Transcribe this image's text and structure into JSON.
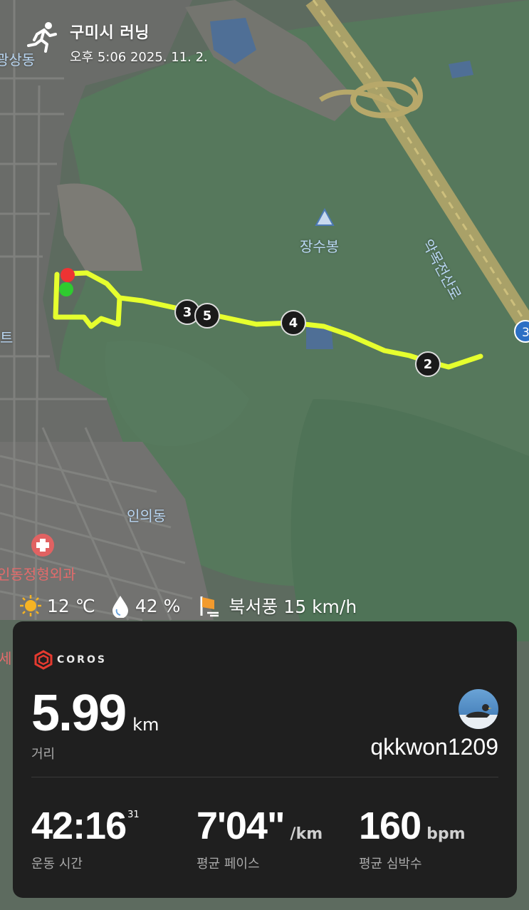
{
  "header": {
    "title": "구미시 러닝",
    "datetime": "오후 5:06 2025. 11. 2."
  },
  "map": {
    "labels": {
      "peak": "장수봉",
      "dong": "인의동",
      "road": "악목전산로",
      "top_left": "광상동",
      "left_edge": "트",
      "left_bottom": "세"
    },
    "poi": {
      "clinic": "인동정형외과"
    },
    "markers": [
      "3",
      "5",
      "4",
      "2"
    ],
    "road_badge": "3"
  },
  "weather": {
    "temp": "12 ℃",
    "humidity": "42 %",
    "wind": "북서풍 15 km/h"
  },
  "card": {
    "brand": "COROS",
    "distance_value": "5.99",
    "distance_unit": "km",
    "distance_label": "거리",
    "username": "qkkwon1209",
    "time_value": "42:16",
    "time_sup": "31",
    "time_label": "운동 시간",
    "pace_value": "7'04\"",
    "pace_unit": "/km",
    "pace_label": "평균 페이스",
    "hr_value": "160",
    "hr_unit": "bpm",
    "hr_label": "평균 심박수"
  }
}
